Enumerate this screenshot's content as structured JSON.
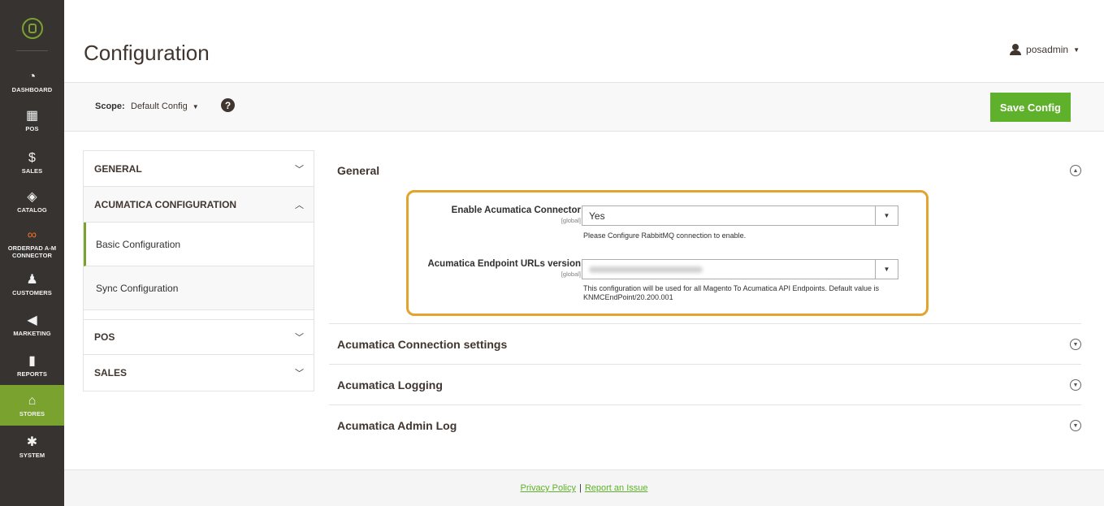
{
  "sidebar": {
    "logo_icon": "magento-logo-icon",
    "items": [
      {
        "label": "DASHBOARD",
        "icon": "◔"
      },
      {
        "label": "POS",
        "icon": "▦"
      },
      {
        "label": "SALES",
        "icon": "$"
      },
      {
        "label": "CATALOG",
        "icon": "◈"
      },
      {
        "label": "ORDERPAD A-M CONNECTOR",
        "icon": "∞"
      },
      {
        "label": "CUSTOMERS",
        "icon": "♟"
      },
      {
        "label": "MARKETING",
        "icon": "◀"
      },
      {
        "label": "REPORTS",
        "icon": "▮"
      },
      {
        "label": "STORES",
        "icon": "⌂"
      },
      {
        "label": "SYSTEM",
        "icon": "✱"
      }
    ],
    "active": "STORES"
  },
  "header": {
    "title": "Configuration",
    "user": "posadmin"
  },
  "scope": {
    "label": "Scope:",
    "value": "Default Config",
    "help": "?",
    "save_label": "Save Config"
  },
  "tabs": {
    "general": "GENERAL",
    "acumatica": "ACUMATICA CONFIGURATION",
    "basic": "Basic Configuration",
    "sync": "Sync Configuration",
    "pos": "POS",
    "sales": "SALES"
  },
  "sections": {
    "general": "General",
    "connection": "Acumatica Connection settings",
    "logging": "Acumatica Logging",
    "admin_log": "Acumatica Admin Log"
  },
  "fields": {
    "enable": {
      "label": "Enable Acumatica Connector",
      "scope": "[global]",
      "value": "Yes",
      "note": "Please Configure RabbitMQ connection to enable."
    },
    "endpoint": {
      "label": "Acumatica Endpoint URLs version",
      "scope": "[global]",
      "note": "This configuration will be used for all Magento To Acumatica API Endpoints. Default value is KNMCEndPoint/20.200.001"
    }
  },
  "footer": {
    "privacy": "Privacy Policy",
    "separator": "|",
    "report": "Report an Issue"
  },
  "colors": {
    "sidebar": "#373330",
    "active": "#79a22e",
    "save": "#5fb12b",
    "highlight": "#e2a42b"
  }
}
